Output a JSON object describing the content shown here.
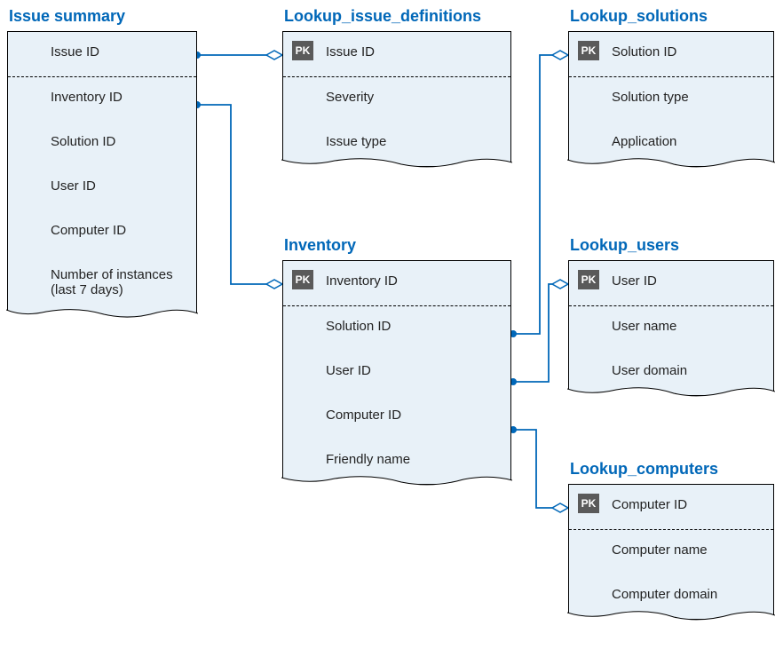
{
  "entities": {
    "issue_summary": {
      "title": "Issue summary",
      "key_field": "Issue ID",
      "fields": [
        "Inventory ID",
        "Solution ID",
        "User ID",
        "Computer ID",
        "Number of instances (last 7 days)"
      ]
    },
    "lookup_issue_definitions": {
      "title": "Lookup_issue_definitions",
      "key_field": "Issue ID",
      "fields": [
        "Severity",
        "Issue type"
      ]
    },
    "lookup_solutions": {
      "title": "Lookup_solutions",
      "key_field": "Solution ID",
      "fields": [
        "Solution type",
        "Application"
      ]
    },
    "inventory": {
      "title": "Inventory",
      "key_field": "Inventory ID",
      "fields": [
        "Solution ID",
        "User ID",
        "Computer ID",
        "Friendly name"
      ]
    },
    "lookup_users": {
      "title": "Lookup_users",
      "key_field": "User ID",
      "fields": [
        "User name",
        "User domain"
      ]
    },
    "lookup_computers": {
      "title": "Lookup_computers",
      "key_field": "Computer ID",
      "fields": [
        "Computer name",
        "Computer domain"
      ]
    }
  },
  "pk_label": "PK"
}
